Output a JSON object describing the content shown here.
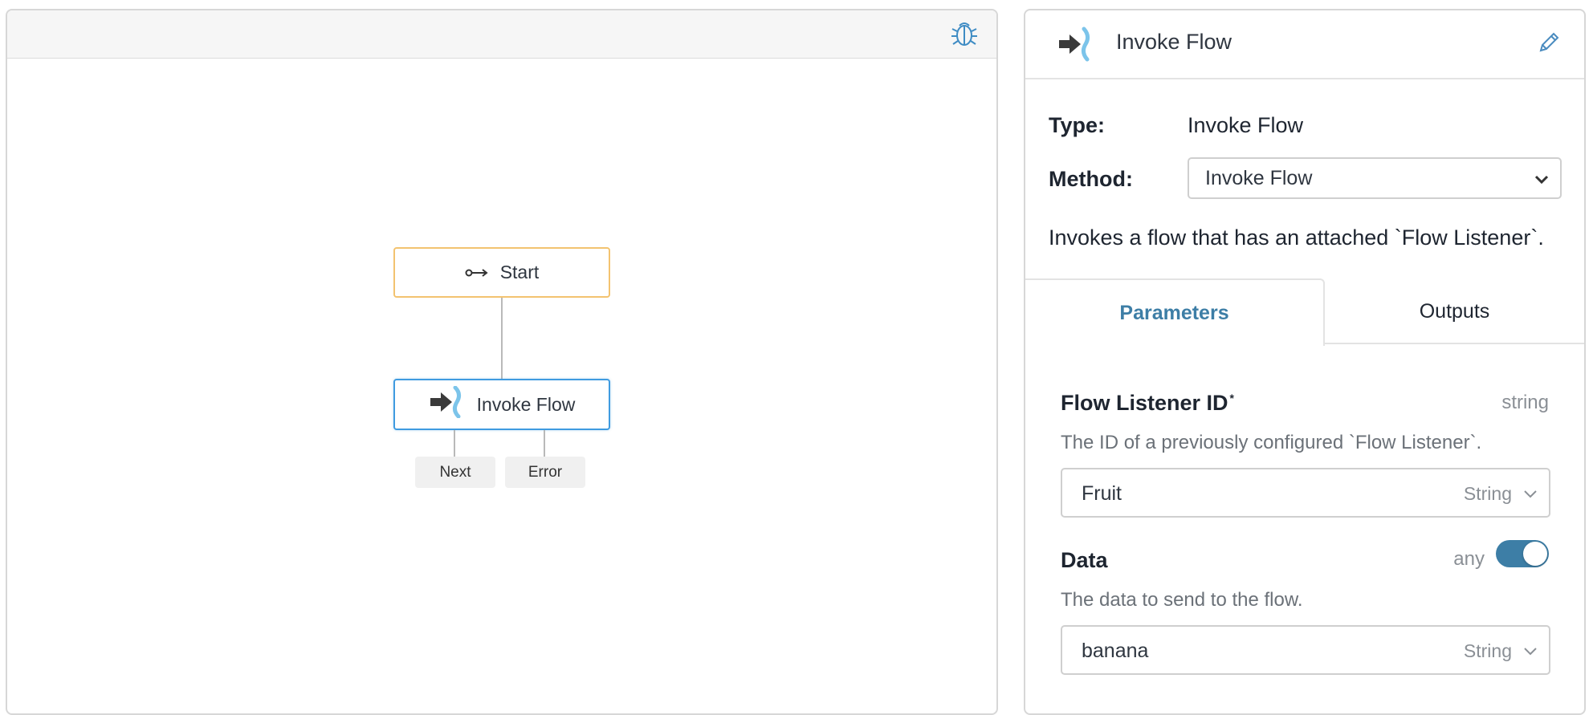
{
  "canvas": {
    "debug_icon": "bug-icon",
    "nodes": {
      "start": {
        "label": "Start",
        "icon": "flow-start-icon",
        "border_color": "#f3c370"
      },
      "invoke": {
        "label": "Invoke Flow",
        "icon": "invoke-flow-icon",
        "border_color": "#3f9be0"
      }
    },
    "ports": {
      "next": "Next",
      "error": "Error"
    }
  },
  "panel": {
    "title": "Invoke Flow",
    "header_icon": "invoke-flow-icon",
    "edit_icon": "pencil-icon",
    "type_label": "Type:",
    "type_value": "Invoke Flow",
    "method_label": "Method:",
    "method_value": "Invoke Flow",
    "description": "Invokes a flow that has an attached `Flow Listener`.",
    "tabs": {
      "parameters": "Parameters",
      "outputs": "Outputs",
      "active": "Parameters"
    },
    "params": {
      "flow_listener": {
        "name": "Flow Listener ID",
        "required_mark": "*",
        "type": "string",
        "description": "The ID of a previously configured `Flow Listener`.",
        "value": "Fruit",
        "value_type": "String"
      },
      "data": {
        "name": "Data",
        "type": "any",
        "toggle_on": true,
        "description": "The data to send to the flow.",
        "value": "banana",
        "value_type": "String"
      }
    }
  },
  "colors": {
    "accent": "#3d7ea6",
    "start_border": "#f3c370",
    "selected_border": "#3f9be0"
  }
}
